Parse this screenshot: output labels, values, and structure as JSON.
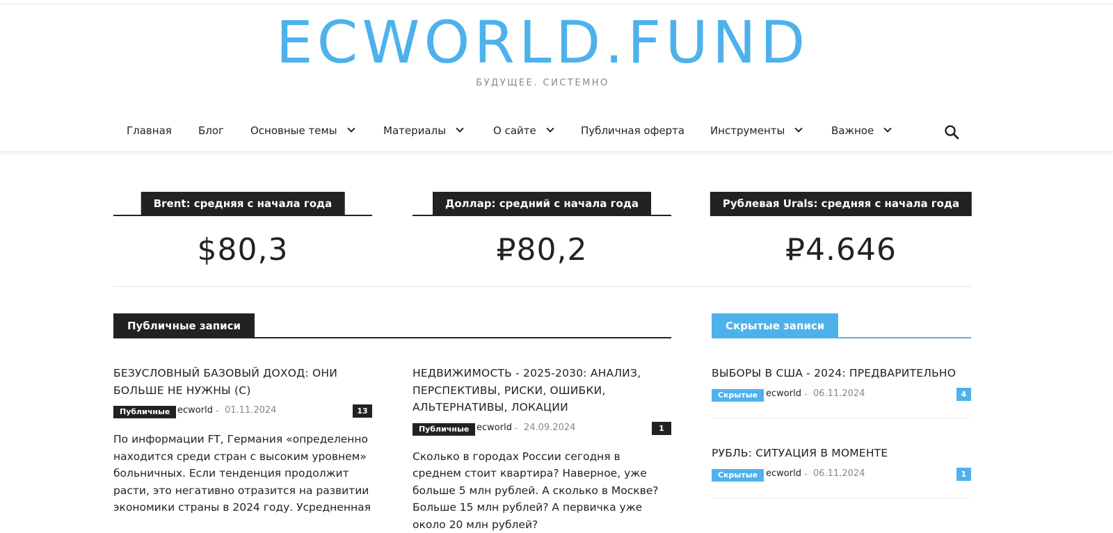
{
  "colors": {
    "brand": "#4db2ec",
    "dark": "#222222",
    "muted": "#888888"
  },
  "header": {
    "logo": "ECWORLD.FUND",
    "tagline": "БУДУЩЕЕ. СИСТЕМНО"
  },
  "nav": {
    "items": [
      {
        "label": "Главная",
        "has_dropdown": false
      },
      {
        "label": "Блог",
        "has_dropdown": false
      },
      {
        "label": "Основные темы",
        "has_dropdown": true
      },
      {
        "label": "Материалы",
        "has_dropdown": true
      },
      {
        "label": "О сайте",
        "has_dropdown": true
      },
      {
        "label": "Публичная оферта",
        "has_dropdown": false
      },
      {
        "label": "Инструменты",
        "has_dropdown": true
      },
      {
        "label": "Важное",
        "has_dropdown": true
      }
    ],
    "search_icon": "search-icon"
  },
  "widgets": [
    {
      "label": "Brent: средняя с начала года",
      "value": "$80,3"
    },
    {
      "label": "Доллар: средний с начала года",
      "value": "₽80,2"
    },
    {
      "label": "Рублевая Urals: средняя с начала года",
      "value": "₽4.646"
    }
  ],
  "public_block": {
    "title": "Публичные записи",
    "posts": [
      {
        "title": "БЕЗУСЛОВНЫЙ БАЗОВЫЙ ДОХОД: ОНИ БОЛЬШЕ НЕ НУЖНЫ (С)",
        "category": "Публичные",
        "author": "ecworld",
        "date": "01.11.2024",
        "comments": "13",
        "excerpt": "По информации FT, Германия «определенно находится среди стран с высоким уровнем» больничных. Если тенденция продолжит расти, это негативно отразится на развитии экономики страны в 2024 году. Усредненная"
      },
      {
        "title": "НЕДВИЖИМОСТЬ - 2025-2030: АНАЛИЗ, ПЕРСПЕКТИВЫ, РИСКИ, ОШИБКИ, АЛЬТЕРНАТИВЫ, ЛОКАЦИИ",
        "category": "Публичные",
        "author": "ecworld",
        "date": "24.09.2024",
        "comments": "1",
        "excerpt": "Сколько в городах России сегодня в среднем стоит квартира? Наверное, уже больше 5 млн рублей. А сколько в Москве? Больше 15 млн рублей? А первичка уже около 20 млн рублей?"
      }
    ]
  },
  "hidden_block": {
    "title": "Скрытые записи",
    "posts": [
      {
        "title": "ВЫБОРЫ В США - 2024: ПРЕДВАРИТЕЛЬНО",
        "category": "Скрытые",
        "author": "ecworld",
        "date": "06.11.2024",
        "comments": "4"
      },
      {
        "title": "РУБЛЬ: СИТУАЦИЯ В МОМЕНТЕ",
        "category": "Скрытые",
        "author": "ecworld",
        "date": "06.11.2024",
        "comments": "1"
      }
    ]
  }
}
